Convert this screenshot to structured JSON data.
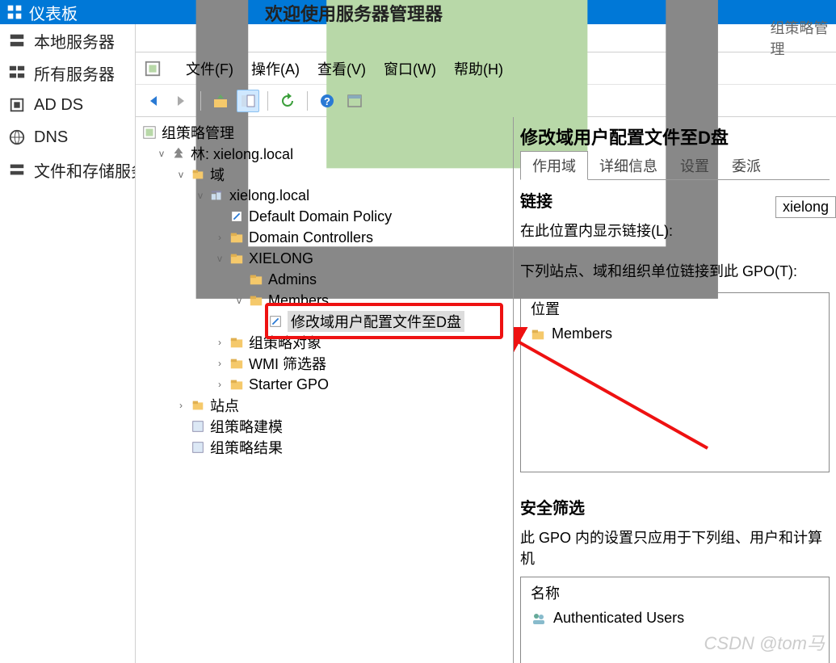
{
  "titlebar": {
    "label": "仪表板"
  },
  "banner": "欢迎使用服务器管理器",
  "leftnav": {
    "items": [
      {
        "label": "本地服务器"
      },
      {
        "label": "所有服务器"
      },
      {
        "label": "AD DS"
      },
      {
        "label": "DNS"
      },
      {
        "label": "文件和存储服务"
      }
    ]
  },
  "window": {
    "title": "组策略管理"
  },
  "menubar": {
    "file": "文件(F)",
    "action": "操作(A)",
    "view": "查看(V)",
    "window": "窗口(W)",
    "help": "帮助(H)"
  },
  "tree": {
    "root": "组策略管理",
    "forest": "林: xielong.local",
    "domains": "域",
    "domain_name": "xielong.local",
    "default_policy": "Default Domain Policy",
    "domain_controllers": "Domain Controllers",
    "ou_xielong": "XIELONG",
    "ou_admins": "Admins",
    "ou_members": "Members",
    "gpo_selected": "修改域用户配置文件至D盘",
    "gpo_objects": "组策略对象",
    "wmi_filters": "WMI 筛选器",
    "starter_gpo": "Starter GPO",
    "sites": "站点",
    "modeling": "组策略建模",
    "results": "组策略结果"
  },
  "detail": {
    "title": "修改域用户配置文件至D盘",
    "tabs": {
      "scope": "作用域",
      "details": "详细信息",
      "settings": "设置",
      "delegation": "委派"
    },
    "links_section": "链接",
    "show_links_label": "在此位置内显示链接(L):",
    "link_value": "xielong",
    "links_text": "下列站点、域和组织单位链接到此 GPO(T):",
    "location_header": "位置",
    "location_value": "Members",
    "sec_filter_title": "安全筛选",
    "sec_filter_text": "此 GPO 内的设置只应用于下列组、用户和计算机",
    "name_header": "名称",
    "name_value": "Authenticated Users"
  },
  "watermark": "CSDN @tom马"
}
